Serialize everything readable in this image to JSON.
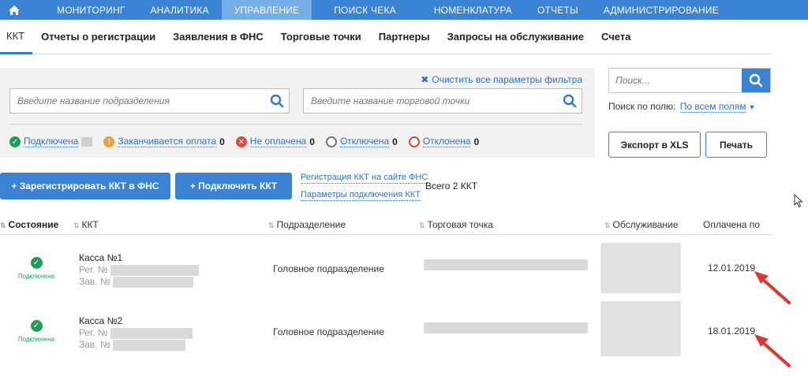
{
  "topnav": {
    "items": [
      {
        "label": "МОНИТОРИНГ"
      },
      {
        "label": "АНАЛИТИКА"
      },
      {
        "label": "УПРАВЛЕНИЕ"
      },
      {
        "label": "ПОИСК ЧЕКА"
      },
      {
        "label": "НОМЕНКЛАТУРА"
      },
      {
        "label": "ОТЧЕТЫ"
      },
      {
        "label": "АДМИНИСТРИРОВАНИЕ"
      }
    ]
  },
  "subnav": {
    "items": [
      {
        "label": "ККТ"
      },
      {
        "label": "Отчеты о регистрации"
      },
      {
        "label": "Заявления в ФНС"
      },
      {
        "label": "Торговые точки"
      },
      {
        "label": "Партнеры"
      },
      {
        "label": "Запросы на обслуживание"
      },
      {
        "label": "Счета"
      }
    ]
  },
  "filters": {
    "clear_label": "Очистить все параметры фильтра",
    "department_placeholder": "Введите название подразделения",
    "store_placeholder": "Введите название торговой точки",
    "statuses": {
      "connected": {
        "label": "Подключена"
      },
      "expiring": {
        "label": "Заканчивается оплата",
        "count": "0"
      },
      "unpaid": {
        "label": "Не оплачена",
        "count": "0"
      },
      "disconnected": {
        "label": "Отключена",
        "count": "0"
      },
      "rejected": {
        "label": "Отклонена",
        "count": "0"
      }
    }
  },
  "search": {
    "placeholder": "Поиск...",
    "by_field_label": "Поиск по полю:",
    "by_field_value": "По всем полям"
  },
  "buttons": {
    "export_xls": "Экспорт в XLS",
    "print": "Печать",
    "register_kkt": "+ Зарегистрировать ККТ в ФНС",
    "connect_kkt": "+ Подключить ККТ"
  },
  "links": {
    "registration_fns": "Регистрация ККТ на сайте ФНС",
    "connection_params": "Параметры подключения ККТ"
  },
  "total": "Всего 2 ККТ",
  "table": {
    "headers": {
      "state": "Состояние",
      "kkt": "ККТ",
      "department": "Подразделение",
      "store": "Торговая точка",
      "service": "Обслуживание",
      "paid_until": "Оплачена по"
    },
    "rows": [
      {
        "state": "Подключена",
        "name": "Касса №1",
        "reg": "Рег. №",
        "serial": "Зав. №",
        "department": "Головное подразделение",
        "paid_until": "12.01.2019"
      },
      {
        "state": "Подключена",
        "name": "Касса №2",
        "reg": "Рег. №",
        "serial": "Зав. №",
        "department": "Головное подразделение",
        "paid_until": "18.01.2019"
      }
    ]
  },
  "colors": {
    "primary": "#3a82d4",
    "active_nav": "#73aee6",
    "link": "#2f73c0",
    "success": "#1e9e5a",
    "warning": "#f0a030",
    "danger": "#e04a3f",
    "annotation_arrow": "#e0352b"
  }
}
